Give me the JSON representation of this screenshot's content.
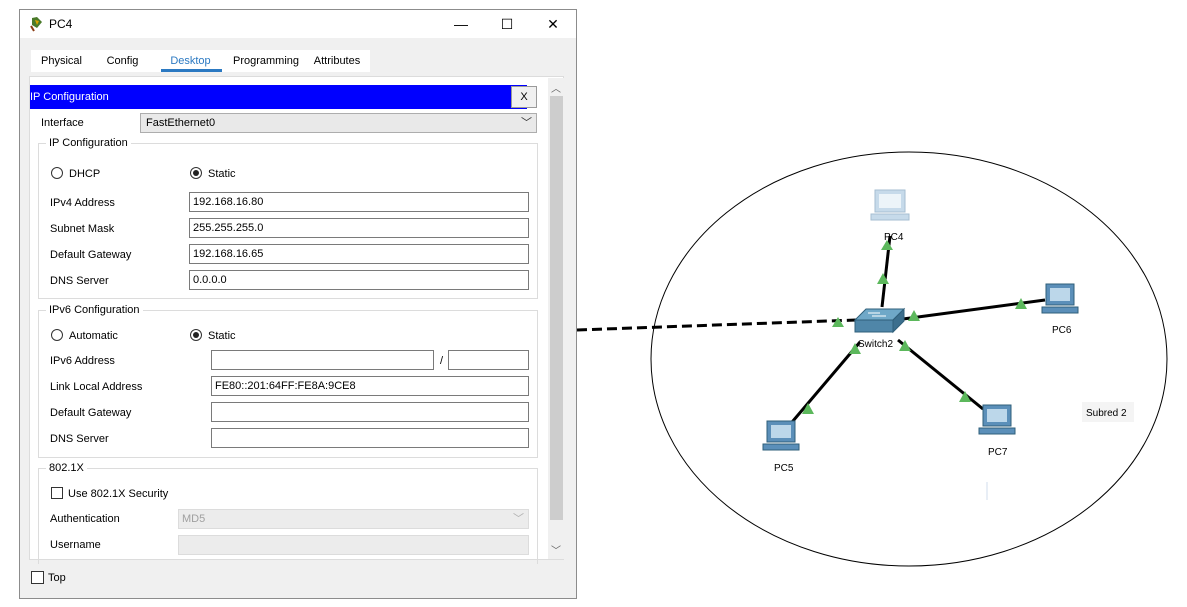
{
  "window": {
    "title": "PC4",
    "minimize": "—",
    "maximize": "☐",
    "close": "✕"
  },
  "tabs": [
    {
      "label": "Physical"
    },
    {
      "label": "Config"
    },
    {
      "label": "Desktop"
    },
    {
      "label": "Programming"
    },
    {
      "label": "Attributes"
    }
  ],
  "active_tab": "Desktop",
  "ip_config": {
    "header": "IP Configuration",
    "close_label": "X",
    "interface_label": "Interface",
    "interface_value": "FastEthernet0",
    "ipv4": {
      "group_title": "IP Configuration",
      "dhcp_label": "DHCP",
      "static_label": "Static",
      "selected": "Static",
      "ipv4_address_label": "IPv4 Address",
      "ipv4_address": "192.168.16.80",
      "subnet_mask_label": "Subnet Mask",
      "subnet_mask": "255.255.255.0",
      "gateway_label": "Default Gateway",
      "gateway": "192.168.16.65",
      "dns_label": "DNS Server",
      "dns": "0.0.0.0"
    },
    "ipv6": {
      "group_title": "IPv6 Configuration",
      "automatic_label": "Automatic",
      "static_label": "Static",
      "selected": "Static",
      "address_label": "IPv6 Address",
      "address": "",
      "prefix_separator": "/",
      "prefix": "",
      "link_local_label": "Link Local Address",
      "link_local": "FE80::201:64FF:FE8A:9CE8",
      "gateway_label": "Default Gateway",
      "gateway": "",
      "dns_label": "DNS Server",
      "dns": ""
    },
    "dot1x": {
      "group_title": "802.1X",
      "use_label": "Use 802.1X Security",
      "use_checked": false,
      "auth_label": "Authentication",
      "auth_value": "MD5",
      "username_label": "Username",
      "username": ""
    }
  },
  "footer": {
    "top_label": "Top",
    "top_checked": false
  },
  "topology": {
    "subnet_label": "Subred 2",
    "switch_label": "Switch2",
    "pcs": [
      "PC4",
      "PC5",
      "PC6",
      "PC7"
    ],
    "link_status_color": "#5cb85c",
    "pc_color": "#5b8fb9"
  }
}
